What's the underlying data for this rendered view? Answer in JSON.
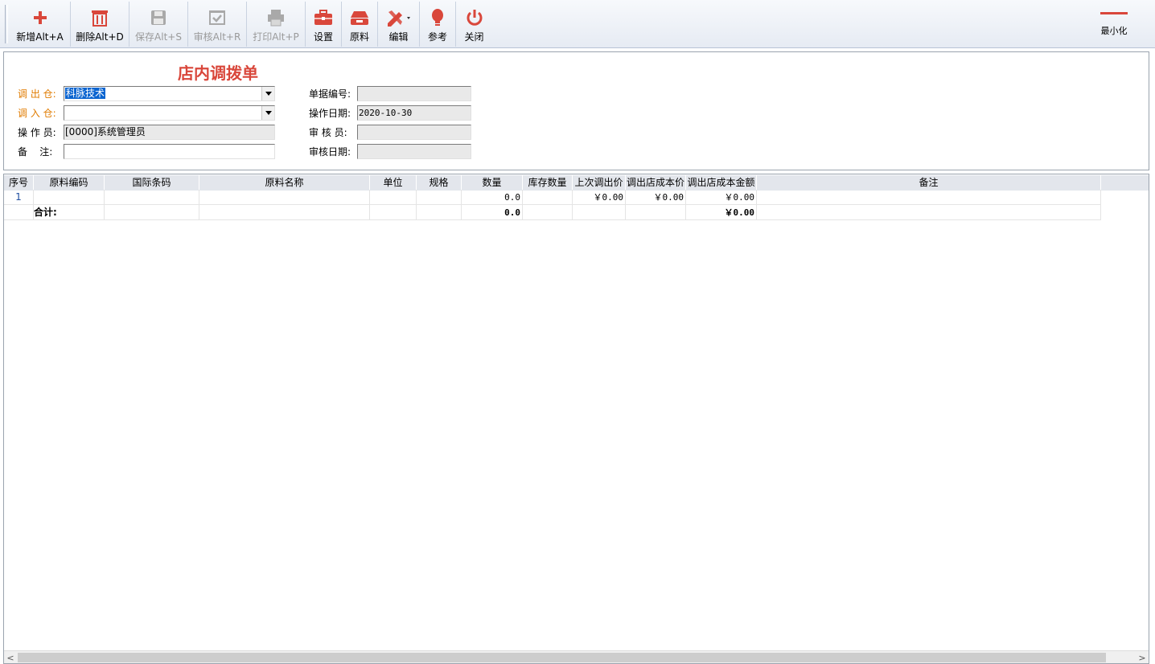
{
  "toolbar": {
    "buttons": [
      {
        "label": "新增Alt+A",
        "icon": "plus-icon",
        "enabled": true
      },
      {
        "label": "删除Alt+D",
        "icon": "trash-icon",
        "enabled": true
      },
      {
        "label": "保存Alt+S",
        "icon": "save-icon",
        "enabled": false
      },
      {
        "label": "审核Alt+R",
        "icon": "approve-icon",
        "enabled": false
      },
      {
        "label": "打印Alt+P",
        "icon": "print-icon",
        "enabled": false
      },
      {
        "label": "设置",
        "icon": "toolbox-icon",
        "enabled": true
      },
      {
        "label": "原料",
        "icon": "material-icon",
        "enabled": true
      },
      {
        "label": "编辑",
        "icon": "edit-icon",
        "enabled": true
      },
      {
        "label": "参考",
        "icon": "lightbulb-icon",
        "enabled": true
      },
      {
        "label": "关闭",
        "icon": "power-icon",
        "enabled": true
      }
    ],
    "minimize_label": "最小化"
  },
  "form": {
    "title": "店内调拨单",
    "out_warehouse_label": "调 出 仓:",
    "out_warehouse_value": "科脉技术",
    "in_warehouse_label": "调 入 仓:",
    "in_warehouse_value": "",
    "operator_label": "操 作 员:",
    "operator_value": "[0000]系统管理员",
    "remark_label": "备    注:",
    "remark_value": "",
    "doc_no_label": "单据编号:",
    "doc_no_value": "",
    "op_date_label": "操作日期:",
    "op_date_value": "2020-10-30",
    "auditor_label": "审 核 员:",
    "auditor_value": "",
    "audit_date_label": "审核日期:",
    "audit_date_value": ""
  },
  "grid": {
    "columns": [
      "序号",
      "原料编码",
      "国际条码",
      "原料名称",
      "单位",
      "规格",
      "数量",
      "库存数量",
      "上次调出价",
      "调出店成本价",
      "调出店成本金额",
      "备注"
    ],
    "rows": [
      {
        "no": "1",
        "code": "",
        "barcode": "",
        "name": "",
        "unit": "",
        "spec": "",
        "qty": "0.0",
        "stock": "",
        "last_price": "￥0.00",
        "cost_price": "￥0.00",
        "cost_amount": "￥0.00",
        "remark": ""
      }
    ],
    "total": {
      "label": "合计:",
      "qty": "0.0",
      "cost_amount": "￥0.00"
    }
  },
  "colors": {
    "accent": "#d9473b",
    "label_orange": "#e07b00",
    "header_bg": "#e3e6ec",
    "selection": "#0a64d0"
  }
}
